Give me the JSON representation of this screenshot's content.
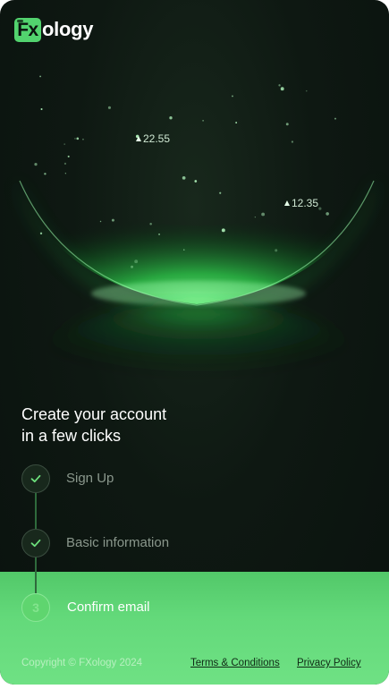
{
  "brand": {
    "logo_prefix": "Fx",
    "logo_suffix": "ology"
  },
  "hero": {
    "ticker_left": "22.55",
    "ticker_right": "12.35"
  },
  "headline": {
    "line1": "Create your account",
    "line2": "in a few clicks"
  },
  "steps": [
    {
      "label": "Sign Up",
      "status": "completed",
      "icon": "check-icon"
    },
    {
      "label": "Basic information",
      "status": "completed",
      "icon": "check-icon"
    },
    {
      "label": "Confirm email",
      "status": "current",
      "number": "3"
    }
  ],
  "footer": {
    "copyright": "Copyright © FXology 2024",
    "terms_link": "Terms & Conditions",
    "privacy_link": "Privacy Policy"
  },
  "colors": {
    "accent": "#5fd56f",
    "background": "#0e1812",
    "band": "#63d97a"
  }
}
